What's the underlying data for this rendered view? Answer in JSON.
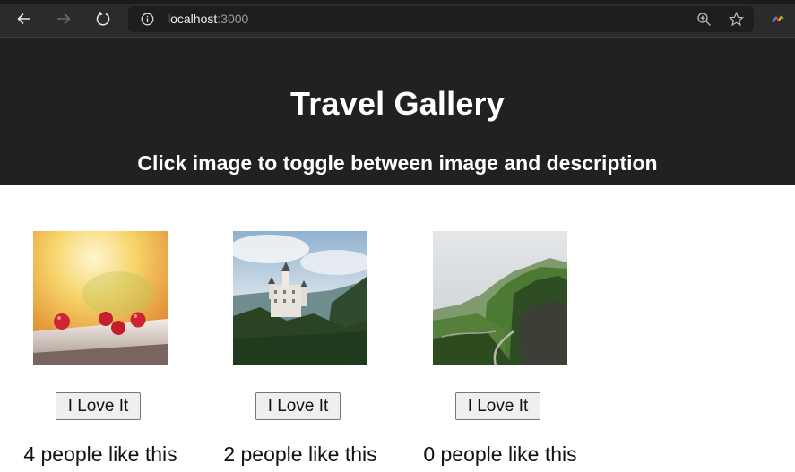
{
  "browser": {
    "url_host": "localhost",
    "url_port": ":3000"
  },
  "header": {
    "title": "Travel Gallery",
    "subtitle": "Click image to toggle between image and description"
  },
  "gallery": {
    "items": [
      {
        "image_icon": "raspberries-photo",
        "button_label": "I Love It",
        "likes_text": "4 people like this"
      },
      {
        "image_icon": "castle-photo",
        "button_label": "I Love It",
        "likes_text": "2 people like this"
      },
      {
        "image_icon": "green-hills-photo",
        "button_label": "I Love It",
        "likes_text": "0 people like this"
      }
    ]
  }
}
